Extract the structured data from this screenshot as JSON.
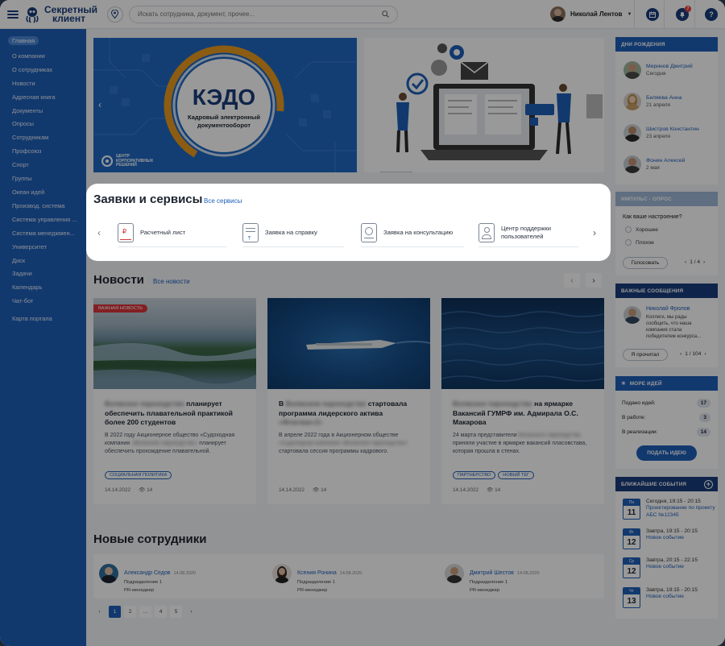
{
  "header": {
    "logo_line1": "Секретный",
    "logo_line2": "клиент",
    "search_placeholder": "Искать сотрудника, документ, прочее...",
    "user_name": "Николай Лентов",
    "notifications_count": "7"
  },
  "sidebar": {
    "items": [
      {
        "label": "Главная",
        "active": true
      },
      {
        "label": "О компании"
      },
      {
        "label": "О сотрудниках"
      },
      {
        "label": "Новости"
      },
      {
        "label": "Адресная книга"
      },
      {
        "label": "Документы"
      },
      {
        "label": "Опросы"
      },
      {
        "label": "Сотрудникам"
      },
      {
        "label": "Профсоюз"
      },
      {
        "label": "Спорт"
      },
      {
        "label": "Группы"
      },
      {
        "label": "Океан идей"
      },
      {
        "label": "Производ. система"
      },
      {
        "label": "Система управления ..."
      },
      {
        "label": "Система менеджмен..."
      },
      {
        "label": "Университет"
      },
      {
        "label": "Диск"
      },
      {
        "label": "Задачи"
      },
      {
        "label": "Календарь"
      },
      {
        "label": "Чат-бот"
      }
    ],
    "portal_map": "Карта портала"
  },
  "banner": {
    "title": "КЭДО",
    "subtitle": "Кадровый электронный документооборот",
    "org_line1": "ЦЕНТР",
    "org_line2": "КОРПОРАТИВНЫХ",
    "org_line3": "РЕШЕНИЙ"
  },
  "services": {
    "title": "Заявки и сервисы",
    "all_link": "Все сервисы",
    "items": [
      {
        "label": "Расчетный лист"
      },
      {
        "label": "Заявка на справку"
      },
      {
        "label": "Заявка на консультацию"
      },
      {
        "label": "Центр поддержки пользователей"
      }
    ]
  },
  "news": {
    "title": "Новости",
    "all_link": "Все новости",
    "hot_label": "ВАЖНАЯ НОВОСТЬ",
    "items": [
      {
        "title_blur": "Волжское пароходство",
        "title": "планирует обеспечить плавательной практикой более 200 студентов",
        "text_start": "В 2022 году Акционерное общество «Судоходная компания",
        "text_blur": "«Волжское пароходство»",
        "text_end": "планирует обеспечить прохождение плавательной.",
        "tags": [
          "СОЦИАЛЬНАЯ ПОЛИТИКА"
        ],
        "date": "14.14.2022",
        "views": "14"
      },
      {
        "title_start": "В",
        "title_blur": "Волжском пароходстве",
        "title": "стартовала программа лидерского актива",
        "title_blur2": "«Флагман-2»",
        "text_start": "В апреле 2022 года в Акционерном обществе",
        "text_blur": "«Судоходная компания «Волжское пароходство»",
        "text_end": "стартовала сессия программы кадрового.",
        "tags": [],
        "date": "14.14.2022",
        "views": "14"
      },
      {
        "title_blur": "Волжское пароходство",
        "title": "на ярмарке Вакансий ГУМРФ им. Адмирала О.С. Макарова",
        "text_start": "24 марта представители",
        "text_blur": "Волжского пароходства",
        "text_end": "приняли участие в ярмарке вакансий пласовстава, которая прошла в стенах.",
        "tags": [
          "ПАРТНЕРСТВО",
          "НОВЫЙ ТЕГ"
        ],
        "date": "14.14.2022",
        "views": "14"
      }
    ]
  },
  "employees": {
    "title": "Новые сотрудники",
    "items": [
      {
        "name": "Александр Седов",
        "date": "14.08.2020",
        "dept": "Подразделение 1",
        "role": "PR-менеджер"
      },
      {
        "name": "Ксения Ронина",
        "date": "14.08.2020",
        "dept": "Подразделение 1",
        "role": "PR-менеджер"
      },
      {
        "name": "Дмитрий Шестов",
        "date": "14.08.2020",
        "dept": "Подразделение 1",
        "role": "PR-менеджер"
      }
    ],
    "pages": [
      "1",
      "2",
      "...",
      "4",
      "5"
    ]
  },
  "birthdays": {
    "title": "ДНИ РОЖДЕНИЯ",
    "items": [
      {
        "name": "Миринов Дмитрий",
        "date": "Сегодня"
      },
      {
        "name": "Беляева Анна",
        "date": "21 апреля"
      },
      {
        "name": "Шистров Константин",
        "date": "23 апреля"
      },
      {
        "name": "Фонин Алексей",
        "date": "2 мая"
      }
    ]
  },
  "poll": {
    "title": "ИМПУЛЬС - ОПРОС",
    "question": "Как ваше настроение?",
    "options": [
      "Хорошее",
      "Плохое"
    ],
    "vote_button": "Голосовать",
    "pager": "1 / 4"
  },
  "important": {
    "title": "ВАЖНЫЕ СООБЩЕНИЯ",
    "author": "Николай Фролов",
    "text": "Коллеги, мы рады сообщить, что наша компания стала победителем конкурса...",
    "read_button": "Я прочитал",
    "pager": "1 / 104"
  },
  "ideas": {
    "title": "МОРЕ ИДЕЙ",
    "stats": [
      {
        "label": "Подано идей:",
        "value": "17"
      },
      {
        "label": "В работе:",
        "value": "3"
      },
      {
        "label": "В реализации:",
        "value": "14"
      }
    ],
    "submit_button": "ПОДАТЬ ИДЕЮ"
  },
  "events": {
    "title": "БЛИЖАЙШИЕ СОБЫТИЯ",
    "items": [
      {
        "day": "Пн",
        "num": "11",
        "time": "Сегодня, 19:15 - 20:15",
        "title": "Проектирование по проекту АБС №12345"
      },
      {
        "day": "Вт",
        "num": "12",
        "time": "Завтра, 19:15 - 20:15",
        "title": "Новое событие"
      },
      {
        "day": "Ср",
        "num": "12",
        "time": "Завтра, 20:15 - 22:15",
        "title": "Новое событие"
      },
      {
        "day": "Чт",
        "num": "13",
        "time": "Завтра, 19:15 - 20:15",
        "title": "Новое событие"
      }
    ]
  }
}
